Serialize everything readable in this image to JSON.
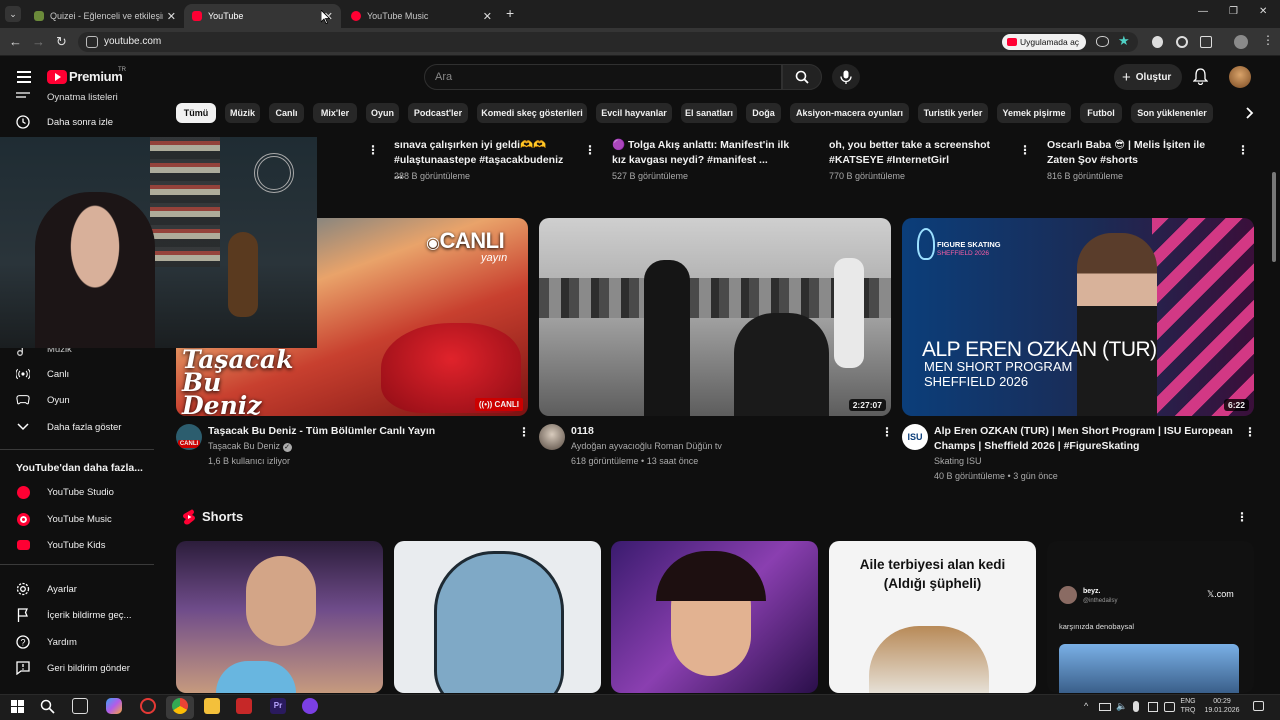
{
  "browser": {
    "tabs": [
      {
        "label": "Quizei - Eğlenceli ve etkileşimli",
        "close": "✕"
      },
      {
        "label": "YouTube",
        "close": "✕"
      },
      {
        "label": "YouTube Music",
        "close": "✕"
      }
    ],
    "new_tab": "+",
    "url": "youtube.com",
    "open_in_app": "Uygulamada aç"
  },
  "header": {
    "logo_text": "Premium",
    "logo_region": "TR",
    "search_placeholder": "Ara",
    "create_label": "Oluştur"
  },
  "chips": [
    "Tümü",
    "Müzik",
    "Canlı",
    "Mix'ler",
    "Oyun",
    "Podcast'ler",
    "Komedi skeç gösterileri",
    "Evcil hayvanlar",
    "El sanatları",
    "Doğa",
    "Aksiyon-macera oyunları",
    "Turistik yerler",
    "Yemek pişirme",
    "Futbol",
    "Son yüklenenler"
  ],
  "sidebar": {
    "top_items": [
      {
        "label": "Oynatma listeleri",
        "icon": "playlist-icon"
      },
      {
        "label": "Daha sonra izle",
        "icon": "clock-icon"
      }
    ],
    "mid_items": [
      {
        "label": "Müzik",
        "icon": "music-icon"
      },
      {
        "label": "Canlı",
        "icon": "live-icon"
      },
      {
        "label": "Oyun",
        "icon": "gamepad-icon"
      },
      {
        "label": "Daha fazla göster",
        "icon": "chevron-down-icon"
      }
    ],
    "more_title": "YouTube'dan daha fazla...",
    "more_items": [
      {
        "label": "YouTube Studio",
        "icon": "youtube-studio-icon"
      },
      {
        "label": "YouTube Music",
        "icon": "youtube-music-icon"
      },
      {
        "label": "YouTube Kids",
        "icon": "youtube-kids-icon"
      }
    ],
    "bottom_items": [
      {
        "label": "Ayarlar",
        "icon": "gear-icon"
      },
      {
        "label": "İçerik bildirme geç...",
        "icon": "flag-icon"
      },
      {
        "label": "Yardım",
        "icon": "help-icon"
      },
      {
        "label": "Geri bildirim gönder",
        "icon": "feedback-icon"
      }
    ]
  },
  "prev_row": [
    {
      "title1": "sınava çalışırken iyi geldi🫶🫶",
      "title2": "#ulaştunaastepe #taşacakbudeniz ...",
      "meta": "288 B görüntüleme"
    },
    {
      "title1": "🟣 Tolga Akış anlattı: Manifest'in ilk",
      "title2": "kız kavgası neydi? #manifest ...",
      "meta": "527 B görüntüleme"
    },
    {
      "title1": "oh, you better take a screenshot",
      "title2": "#KATSEYE #InternetGirl",
      "meta": "770 B görüntüleme"
    },
    {
      "title1": "Oscarlı Baba 😎 | Melis İşiten ile",
      "title2": "Zaten Şov #shorts",
      "meta": "816 B görüntüleme"
    }
  ],
  "videos": [
    {
      "thumb_overlay_title": "Taşacak Bu Deniz",
      "thumb_live_badge": "CANLI",
      "thumb_live_sub": "yayın",
      "badge": "CANLI",
      "avatar_badge": "CANLI",
      "title": "Taşacak Bu Deniz - Tüm Bölümler Canlı Yayın",
      "channel": "Taşacak Bu Deniz",
      "meta": "1,6 B kullanıcı izliyor"
    },
    {
      "duration": "2:27:07",
      "title": "0118",
      "channel": "Aydoğan ayvacıoğlu Roman Düğün tv",
      "meta": "618 görüntüleme • 13 saat önce"
    },
    {
      "duration": "6:22",
      "thumb_brand": "FIGURE SKATING",
      "thumb_event": "SHEFFIELD 2026",
      "thumb_name": "ALP EREN OZKAN (TUR)",
      "thumb_program": "MEN SHORT PROGRAM",
      "thumb_place": "SHEFFIELD 2026",
      "avatar_text": "ISU",
      "title1": "Alp Eren OZKAN (TUR) | Men Short Program | ISU European",
      "title2": "Champs | Sheffield 2026 | #FigureSkating",
      "channel": "Skating ISU",
      "meta": "40 B görüntüleme • 3 gün önce"
    }
  ],
  "shorts": {
    "title": "Shorts",
    "card4_caption_line1": "Aile terbiyesi alan kedi",
    "card4_caption_line2": "(Aldığı şüpheli)",
    "card5_user": "beyz.",
    "card5_handle": "@inthedailsy",
    "card5_source": "𝕏.com",
    "card5_text": "karşınızda denobaysal"
  },
  "taskbar": {
    "lang1": "ENG",
    "lang2": "TRQ",
    "time": "00:29",
    "date": "19.01.2026"
  }
}
